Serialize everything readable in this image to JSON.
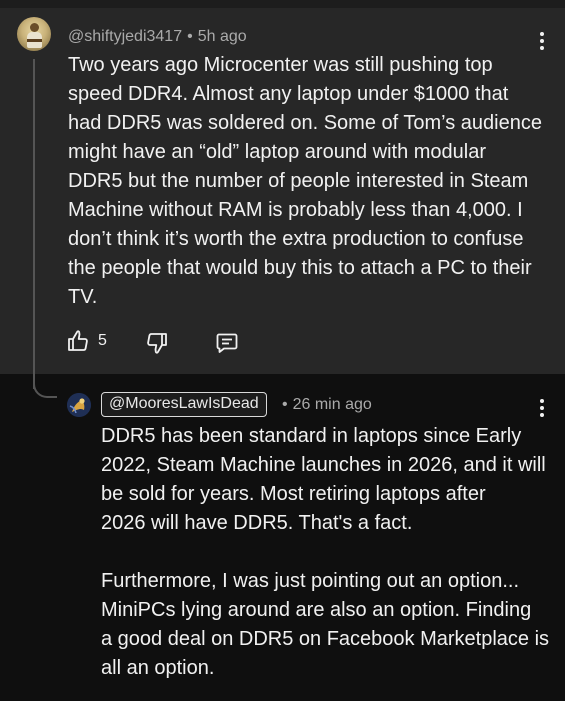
{
  "parent": {
    "author": "@shiftyjedi3417",
    "time": "5h ago",
    "lines": [
      "Two years ago Microcenter was still pushing top",
      "speed DDR4. Almost any laptop under $1000 that",
      "had DDR5 was soldered on. Some of Tom’s audience",
      "might have an “old” laptop around with modular",
      "DDR5 but the number of people interested in Steam",
      "Machine without RAM is probably less than 4,000. I",
      "don’t think it’s worth the extra production to confuse",
      "the people that would buy this to attach a PC to their",
      "TV."
    ],
    "like_count": "5",
    "icons": {
      "like": "thumbs-up-icon",
      "dislike": "thumbs-down-icon",
      "reply": "comment-reply-icon",
      "menu": "more-vert-icon"
    }
  },
  "reply": {
    "author": "@MooresLawIsDead",
    "time": "26 min ago",
    "lines": [
      "DDR5 has been standard in laptops since Early",
      "2022, Steam Machine launches in 2026, and it will",
      "be sold for years.  Most retiring laptops after",
      "2026 will have DDR5. That's a fact.",
      "",
      "Furthermore, I was just pointing out an option...",
      "MiniPCs lying around are also an option.  Finding",
      "a good deal on DDR5 on Facebook Marketplace is",
      "all an option."
    ],
    "icons": {
      "menu": "more-vert-icon"
    }
  },
  "colors": {
    "parent_bg": "#272727",
    "page_bg": "#0f0f0f",
    "text": "#f1f1f1",
    "meta": "#aaaaaa"
  }
}
